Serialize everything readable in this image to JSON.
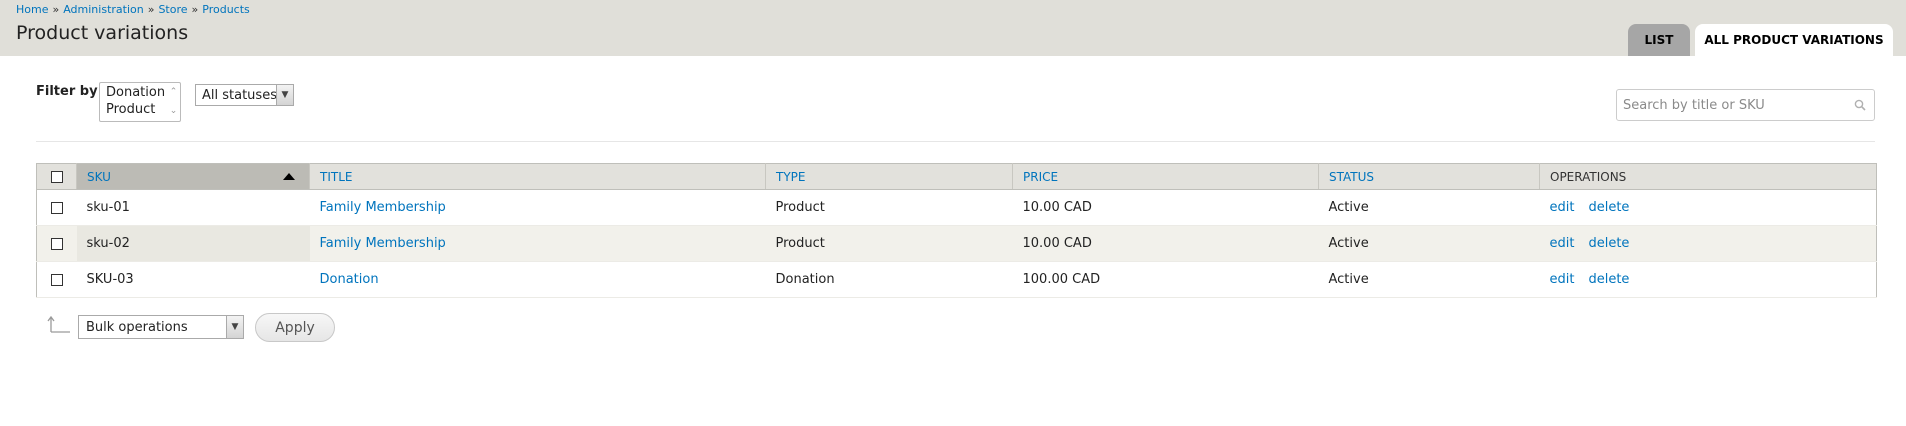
{
  "breadcrumb": {
    "items": [
      "Home",
      "Administration",
      "Store",
      "Products"
    ],
    "separator": "»"
  },
  "page": {
    "title": "Product variations"
  },
  "tabs": [
    {
      "label": "LIST",
      "active": false
    },
    {
      "label": "ALL PRODUCT VARIATIONS",
      "active": true
    }
  ],
  "filters": {
    "label": "Filter by",
    "type_options": [
      "Donation",
      "Product"
    ],
    "status_selected": "All statuses",
    "search_placeholder": "Search by title or SKU"
  },
  "table": {
    "columns": [
      "SKU",
      "TITLE",
      "TYPE",
      "PRICE",
      "STATUS",
      "OPERATIONS"
    ],
    "sorted_column": "SKU",
    "rows": [
      {
        "sku": "sku-01",
        "title": "Family Membership",
        "type": "Product",
        "price": "10.00 CAD",
        "status": "Active"
      },
      {
        "sku": "sku-02",
        "title": "Family Membership",
        "type": "Product",
        "price": "10.00 CAD",
        "status": "Active"
      },
      {
        "sku": "SKU-03",
        "title": "Donation",
        "type": "Donation",
        "price": "100.00 CAD",
        "status": "Active"
      }
    ],
    "operations": {
      "edit": "edit",
      "delete": "delete"
    }
  },
  "bulk": {
    "selected": "Bulk operations",
    "apply_label": "Apply"
  },
  "colors": {
    "header_bg": "#e0dfd9",
    "link": "#0074bd",
    "tab_inactive": "#a6a6a6",
    "sorted_header": "#bcbbb5"
  }
}
